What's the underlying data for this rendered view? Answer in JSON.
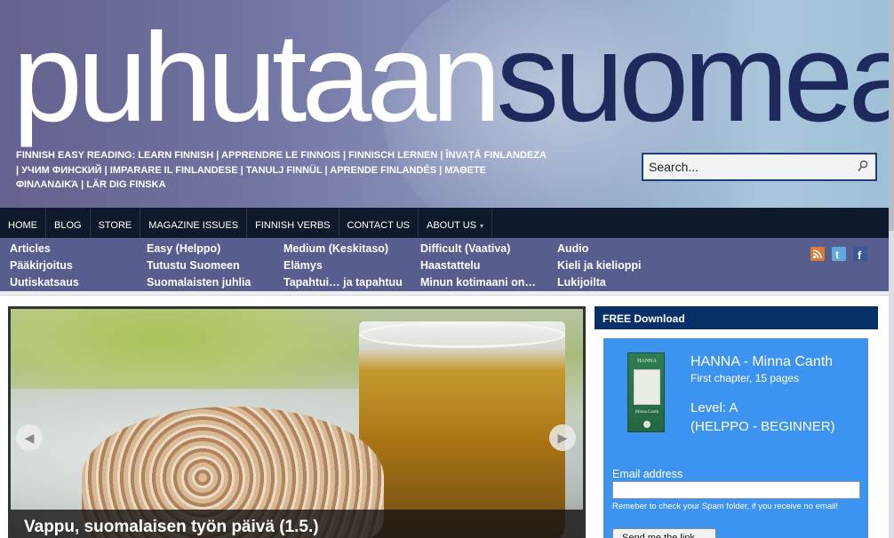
{
  "header": {
    "logo_part1": "puhutaan",
    "logo_part2": "suomea",
    "tagline": "FINNISH EASY READING: LEARN FINNISH | APPRENDRE LE FINNOIS | FINNISCH LERNEN | ÎNVAȚĂ FINLANDEZA | УЧИМ ФИНСКИЙ | IMPARARE IL FINLANDESE | TANULJ FINNÜL | APRENDE FINLANDÉS | ΜΆΘΕΤΕ ΦΙΝΛΑΝΔΙΚΆ | LÄR DIG FINSKA",
    "search_placeholder": "Search..."
  },
  "nav": [
    {
      "label": "HOME"
    },
    {
      "label": "BLOG"
    },
    {
      "label": "STORE"
    },
    {
      "label": "MAGAZINE ISSUES"
    },
    {
      "label": "FINNISH VERBS"
    },
    {
      "label": "CONTACT US"
    },
    {
      "label": "ABOUT US",
      "caret": "▾"
    }
  ],
  "categories": [
    [
      "Articles",
      "Pääkirjoitus",
      "Uutiskatsaus"
    ],
    [
      "Easy (Helppo)",
      "Tutustu Suomeen",
      "Suomalaisten juhlia"
    ],
    [
      "Medium (Keskitaso)",
      "Elämys",
      "Tapahtui… ja tapahtuu"
    ],
    [
      "Difficult (Vaativa)",
      "Haastattelu",
      "Minun kotimaani on…"
    ],
    [
      "Audio",
      "Kieli ja kielioppi",
      "Lukijoilta"
    ]
  ],
  "social": [
    {
      "icon": "rss-icon",
      "color": "#d9793a"
    },
    {
      "icon": "twitter-icon",
      "color": "#5fa9dd"
    },
    {
      "icon": "facebook-icon",
      "color": "#3b5998"
    }
  ],
  "slider": {
    "caption": "Vappu, suomalaisen työn päivä (1.5.)",
    "prev": "◀",
    "next": "▶"
  },
  "widget": {
    "title": "FREE Download",
    "book_title": "HANNA - Minna Canth",
    "book_sub": "First chapter, 15 pages",
    "level": "Level: A",
    "level_desc": "(HELPPO - BEGINNER)",
    "email_label": "Email address",
    "email_value": "",
    "note": "Remeber to check your Spam folder, if you receive no email!",
    "button": "Send me the link",
    "cover_title": "HANNA",
    "cover_author": "Minna Canth"
  },
  "colors": {
    "nav_bg": "#0e1a2b",
    "category_bg": "#575d8d",
    "widget_header": "#083068",
    "widget_box": "#3d93f0",
    "logo_dark": "#1f2a5c"
  }
}
